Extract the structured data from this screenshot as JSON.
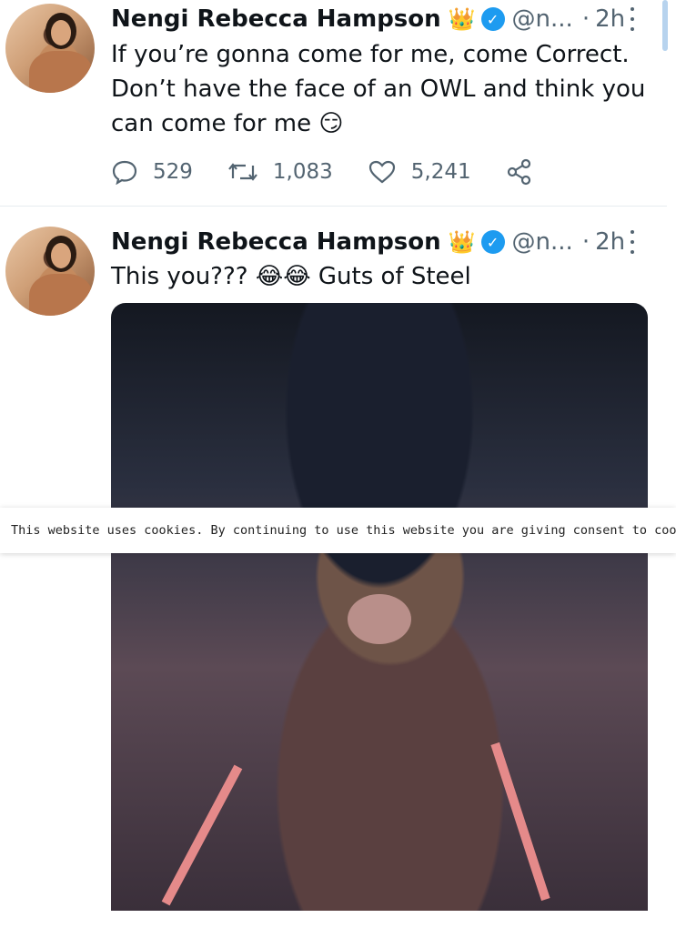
{
  "tweets": [
    {
      "name": "Nengi Rebecca Hampson",
      "badge_emoji": "👑",
      "verified": "✓",
      "handle": "@n...",
      "separator": "·",
      "time": "2h",
      "text_line1": "If you’re gonna come for me, come Correct.",
      "text_line2": "Don’t have the face of an OWL and think you",
      "text_line3": "can come for me",
      "text_emoji": "😏",
      "replies": "529",
      "retweets": "1,083",
      "likes": "5,241"
    },
    {
      "name": "Nengi Rebecca Hampson",
      "badge_emoji": "👑",
      "verified": "✓",
      "handle": "@n...",
      "separator": "·",
      "time": "2h",
      "text_start": "This you???",
      "text_emoji": "😂😂",
      "text_end": "Guts of Steel"
    }
  ],
  "cookie_banner": {
    "text": "This website uses cookies. By continuing to use this website you are giving consent to cookies being used."
  },
  "colors": {
    "accent": "#1d9bf0",
    "muted": "#536471",
    "text": "#0f1419"
  },
  "icons": [
    "reply-icon",
    "retweet-icon",
    "like-icon",
    "share-icon",
    "more-icon",
    "verified-icon"
  ]
}
